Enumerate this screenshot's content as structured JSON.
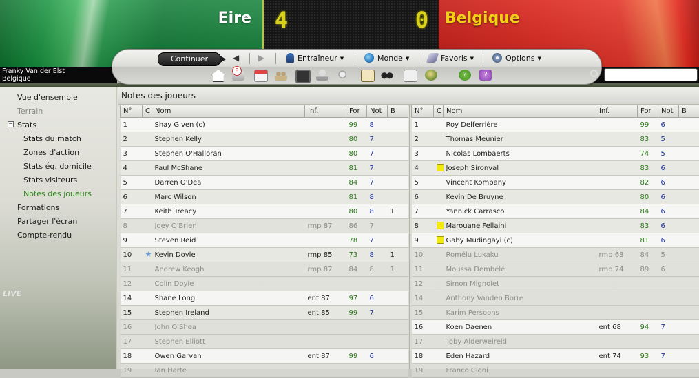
{
  "header": {
    "home_team": "Eire",
    "away_team": "Belgique",
    "home_score": "4",
    "away_score": "0",
    "colors": {
      "home": "#169640",
      "away": "#d9271d",
      "scoreboard": "#161616",
      "digits": "#d9d21c"
    }
  },
  "nav": {
    "continue_label": "Continuer",
    "menus": [
      "Entraîneur",
      "Monde",
      "Favoris",
      "Options"
    ],
    "inbox_count": "8",
    "tool_icons": [
      "home-icon",
      "inbox-icon",
      "calendar-icon",
      "staff-icon",
      "tactics-board-icon",
      "trophy-icon",
      "scouting-icon",
      "clipboard-icon",
      "binoculars-icon",
      "report-icon",
      "world-icon",
      "help-icon",
      "help-alt-icon"
    ]
  },
  "user": {
    "name": "Franky Van der Elst",
    "team": "Belgique"
  },
  "search": {
    "placeholder": ""
  },
  "sidebar": {
    "items": [
      {
        "label": "Vue d'ensemble",
        "state": "normal"
      },
      {
        "label": "Terrain",
        "state": "dim"
      },
      {
        "label": "Stats",
        "state": "normal"
      },
      {
        "label": "Stats du match",
        "state": "normal"
      },
      {
        "label": "Zones d'action",
        "state": "normal"
      },
      {
        "label": "Stats éq. domicile",
        "state": "normal"
      },
      {
        "label": "Stats visiteurs",
        "state": "normal"
      },
      {
        "label": "Notes des joueurs",
        "state": "active"
      },
      {
        "label": "Formations",
        "state": "normal"
      },
      {
        "label": "Partager l'écran",
        "state": "normal"
      },
      {
        "label": "Compte-rendu",
        "state": "normal"
      }
    ],
    "toggle": "−"
  },
  "main": {
    "title": "Notes des joueurs",
    "columns": [
      "N°",
      "C",
      "Nom",
      "Inf.",
      "For",
      "Not",
      "B"
    ],
    "home_players": [
      {
        "no": "1",
        "c": "",
        "name": "Shay Given (c)",
        "inf": "",
        "for": "99",
        "not": "8",
        "b": "",
        "unused": false
      },
      {
        "no": "2",
        "c": "",
        "name": "Stephen Kelly",
        "inf": "",
        "for": "80",
        "not": "7",
        "b": "",
        "unused": false
      },
      {
        "no": "3",
        "c": "",
        "name": "Stephen O'Halloran",
        "inf": "",
        "for": "80",
        "not": "7",
        "b": "",
        "unused": false
      },
      {
        "no": "4",
        "c": "",
        "name": "Paul McShane",
        "inf": "",
        "for": "81",
        "not": "7",
        "b": "",
        "unused": false
      },
      {
        "no": "5",
        "c": "",
        "name": "Darren O'Dea",
        "inf": "",
        "for": "84",
        "not": "7",
        "b": "",
        "unused": false
      },
      {
        "no": "6",
        "c": "",
        "name": "Marc Wilson",
        "inf": "",
        "for": "81",
        "not": "8",
        "b": "",
        "unused": false
      },
      {
        "no": "7",
        "c": "",
        "name": "Keith Treacy",
        "inf": "",
        "for": "80",
        "not": "8",
        "b": "1",
        "unused": false
      },
      {
        "no": "8",
        "c": "",
        "name": "Joey O'Brien",
        "inf": "rmp 87",
        "for": "86",
        "not": "7",
        "b": "",
        "unused": true
      },
      {
        "no": "9",
        "c": "",
        "name": "Steven Reid",
        "inf": "",
        "for": "78",
        "not": "7",
        "b": "",
        "unused": false
      },
      {
        "no": "10",
        "c": "star",
        "name": "Kevin Doyle",
        "inf": "rmp 85",
        "for": "73",
        "not": "8",
        "b": "1",
        "unused": false
      },
      {
        "no": "11",
        "c": "",
        "name": "Andrew Keogh",
        "inf": "rmp 87",
        "for": "84",
        "not": "8",
        "b": "1",
        "unused": true
      },
      {
        "no": "12",
        "c": "",
        "name": "Colin Doyle",
        "inf": "",
        "for": "",
        "not": "",
        "b": "",
        "unused": true
      },
      {
        "no": "14",
        "c": "",
        "name": "Shane Long",
        "inf": "ent 87",
        "for": "97",
        "not": "6",
        "b": "",
        "unused": false
      },
      {
        "no": "15",
        "c": "",
        "name": "Stephen Ireland",
        "inf": "ent 85",
        "for": "99",
        "not": "7",
        "b": "",
        "unused": false
      },
      {
        "no": "16",
        "c": "",
        "name": "John O'Shea",
        "inf": "",
        "for": "",
        "not": "",
        "b": "",
        "unused": true
      },
      {
        "no": "17",
        "c": "",
        "name": "Stephen Elliott",
        "inf": "",
        "for": "",
        "not": "",
        "b": "",
        "unused": true
      },
      {
        "no": "18",
        "c": "",
        "name": "Owen Garvan",
        "inf": "ent 87",
        "for": "99",
        "not": "6",
        "b": "",
        "unused": false
      },
      {
        "no": "19",
        "c": "",
        "name": "Ian Harte",
        "inf": "",
        "for": "",
        "not": "",
        "b": "",
        "unused": true
      }
    ],
    "away_players": [
      {
        "no": "1",
        "c": "",
        "name": "Roy Delferrière",
        "inf": "",
        "for": "99",
        "not": "6",
        "b": "",
        "unused": false
      },
      {
        "no": "2",
        "c": "",
        "name": "Thomas Meunier",
        "inf": "",
        "for": "83",
        "not": "5",
        "b": "",
        "unused": false
      },
      {
        "no": "3",
        "c": "",
        "name": "Nicolas Lombaerts",
        "inf": "",
        "for": "74",
        "not": "5",
        "b": "",
        "unused": false
      },
      {
        "no": "4",
        "c": "yellow",
        "name": "Joseph Sironval",
        "inf": "",
        "for": "83",
        "not": "6",
        "b": "",
        "unused": false
      },
      {
        "no": "5",
        "c": "",
        "name": "Vincent Kompany",
        "inf": "",
        "for": "82",
        "not": "6",
        "b": "",
        "unused": false
      },
      {
        "no": "6",
        "c": "",
        "name": "Kevin De Bruyne",
        "inf": "",
        "for": "80",
        "not": "6",
        "b": "",
        "unused": false
      },
      {
        "no": "7",
        "c": "",
        "name": "Yannick Carrasco",
        "inf": "",
        "for": "84",
        "not": "6",
        "b": "",
        "unused": false
      },
      {
        "no": "8",
        "c": "yellow",
        "name": "Marouane Fellaini",
        "inf": "",
        "for": "83",
        "not": "6",
        "b": "",
        "unused": false
      },
      {
        "no": "9",
        "c": "yellow",
        "name": "Gaby Mudingayi (c)",
        "inf": "",
        "for": "81",
        "not": "6",
        "b": "",
        "unused": false
      },
      {
        "no": "10",
        "c": "",
        "name": "Romélu Lukaku",
        "inf": "rmp 68",
        "for": "84",
        "not": "5",
        "b": "",
        "unused": true
      },
      {
        "no": "11",
        "c": "",
        "name": "Moussa Dembélé",
        "inf": "rmp 74",
        "for": "89",
        "not": "6",
        "b": "",
        "unused": true
      },
      {
        "no": "12",
        "c": "",
        "name": "Simon Mignolet",
        "inf": "",
        "for": "",
        "not": "",
        "b": "",
        "unused": true
      },
      {
        "no": "14",
        "c": "",
        "name": "Anthony Vanden Borre",
        "inf": "",
        "for": "",
        "not": "",
        "b": "",
        "unused": true
      },
      {
        "no": "15",
        "c": "",
        "name": "Karim Persoons",
        "inf": "",
        "for": "",
        "not": "",
        "b": "",
        "unused": true
      },
      {
        "no": "16",
        "c": "",
        "name": "Koen Daenen",
        "inf": "ent 68",
        "for": "94",
        "not": "7",
        "b": "",
        "unused": false
      },
      {
        "no": "17",
        "c": "",
        "name": "Toby Alderweireld",
        "inf": "",
        "for": "",
        "not": "",
        "b": "",
        "unused": true
      },
      {
        "no": "18",
        "c": "",
        "name": "Eden Hazard",
        "inf": "ent 74",
        "for": "93",
        "not": "7",
        "b": "",
        "unused": false
      },
      {
        "no": "19",
        "c": "",
        "name": "Franco Cioni",
        "inf": "",
        "for": "",
        "not": "",
        "b": "",
        "unused": true
      }
    ]
  }
}
